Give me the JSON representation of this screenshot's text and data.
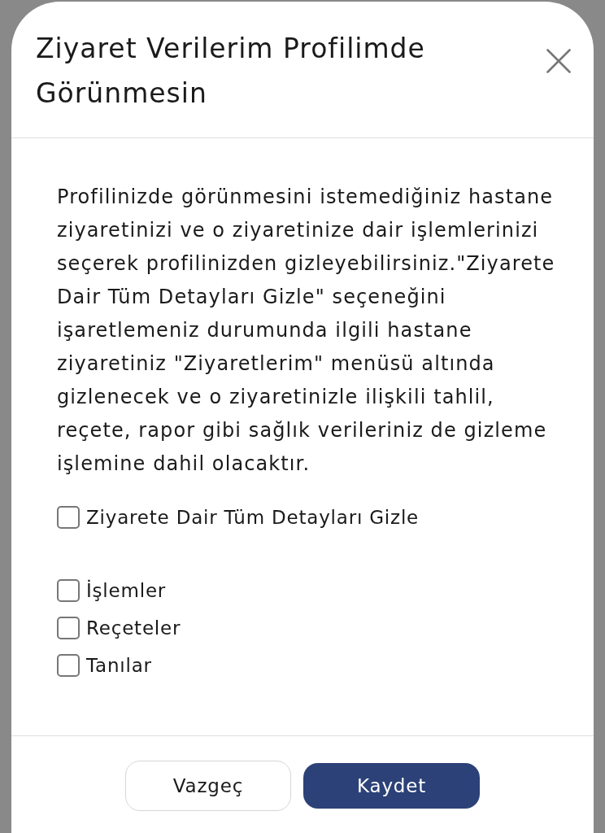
{
  "dialog": {
    "title": "Ziyaret Verilerim Profilimde Görünmesin",
    "description": "Profilinizde görünmesini istemediğiniz hastane ziyaretinizi ve o ziyaretinize dair işlemlerinizi seçerek profilinizden gizleyebilirsiniz.\"Ziyarete Dair Tüm Detayları Gizle\" seçeneğini işaretlemeniz durumunda ilgili hastane ziyaretiniz \"Ziyaretlerim\" menüsü altında gizlenecek ve o ziyaretinizle ilişkili tahlil, reçete, rapor gibi sağlık verileriniz de gizleme işlemine dahil olacaktır.",
    "master_option": {
      "label": "Ziyarete Dair Tüm Detayları Gizle",
      "checked": false
    },
    "options": [
      {
        "label": "İşlemler",
        "checked": false
      },
      {
        "label": "Reçeteler",
        "checked": false
      },
      {
        "label": "Tanılar",
        "checked": false
      }
    ],
    "buttons": [
      {
        "label": "Vazgeç",
        "kind": "secondary"
      },
      {
        "label": "Kaydet",
        "kind": "primary"
      }
    ]
  }
}
